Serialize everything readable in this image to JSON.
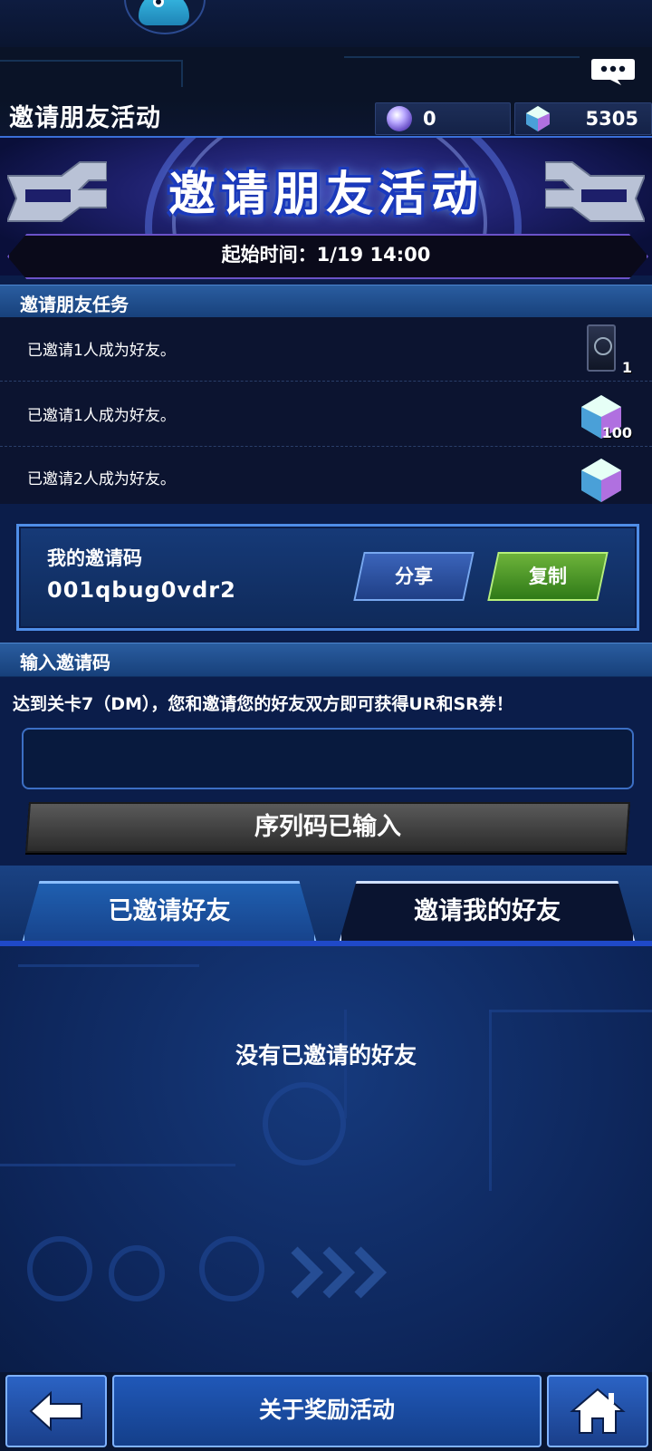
{
  "header": {
    "title": "邀请朋友活动",
    "currency_orbs": "0",
    "currency_gems": "5305"
  },
  "banner": {
    "title": "邀请朋友活动",
    "start_time": "起始时间：1/19 14:00"
  },
  "quests": {
    "section_title": "邀请朋友任务",
    "items": [
      {
        "text": "已邀请1人成为好友。",
        "reward_qty": "1",
        "reward_icon": "card-pack-icon"
      },
      {
        "text": "已邀请1人成为好友。",
        "reward_qty": "100",
        "reward_icon": "gem-icon"
      },
      {
        "text": "已邀请2人成为好友。",
        "reward_qty": "",
        "reward_icon": "gem-icon"
      }
    ]
  },
  "my_code": {
    "label": "我的邀请码",
    "value": "001qbug0vdr2",
    "share_label": "分享",
    "copy_label": "复制"
  },
  "enter_code": {
    "section_title": "输入邀请码",
    "hint": "达到关卡7（DM），您和邀请您的好友双方即可获得UR和SR券！",
    "input_value": "",
    "button_label": "序列码已输入"
  },
  "tabs": {
    "invited": "已邀请好友",
    "inviter": "邀请我的好友"
  },
  "list": {
    "empty_message": "没有已邀请的好友"
  },
  "bottom": {
    "about_label": "关于奖励活动"
  },
  "colors": {
    "background": "#0b1d4a",
    "accent": "#4f8ee8",
    "copy_button": "#6db33a"
  }
}
